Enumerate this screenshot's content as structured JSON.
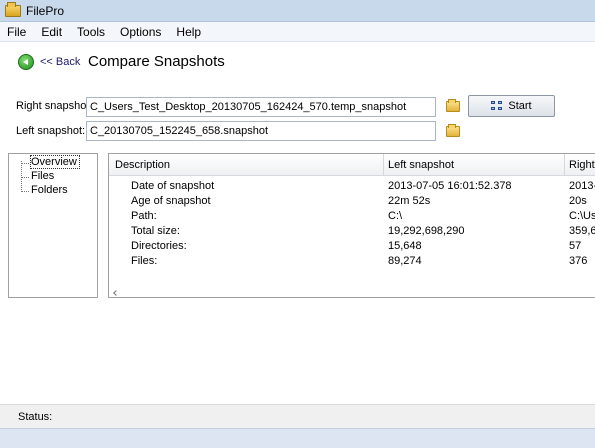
{
  "window": {
    "title": "FilePro"
  },
  "menu": {
    "items": [
      "File",
      "Edit",
      "Tools",
      "Options",
      "Help"
    ]
  },
  "header": {
    "back_label": "<< Back",
    "title": "Compare Snapshots"
  },
  "form": {
    "right_label": "Right snapshot:",
    "right_value": "C_Users_Test_Desktop_20130705_162424_570.temp_snapshot",
    "left_label": "Left snapshot:",
    "left_value": "C_20130705_152245_658.snapshot",
    "start_label": "Start"
  },
  "tree": {
    "items": [
      "Overview",
      "Files",
      "Folders"
    ],
    "selected": "Overview"
  },
  "table": {
    "columns": [
      "Description",
      "Left snapshot",
      "Right"
    ],
    "rows": [
      [
        "Date of snapshot",
        "2013-07-05 16:01:52.378",
        "2013-"
      ],
      [
        "Age of snapshot",
        "22m 52s",
        "20s"
      ],
      [
        "Path:",
        "C:\\",
        "C:\\Us"
      ],
      [
        "Total size:",
        "19,292,698,290",
        "359,6"
      ],
      [
        "Directories:",
        "15,648",
        "57"
      ],
      [
        "Files:",
        "89,274",
        "376"
      ]
    ]
  },
  "status": {
    "label": "Status:"
  },
  "icons": {
    "app": "folder-app-icon",
    "back": "green-back-arrow-icon",
    "browse": "folder-icon",
    "start": "network-nodes-icon"
  },
  "colors": {
    "titlebar": "#c9d9ec",
    "back_icon": "#1e8b1e",
    "folder": "#e3b43a"
  }
}
